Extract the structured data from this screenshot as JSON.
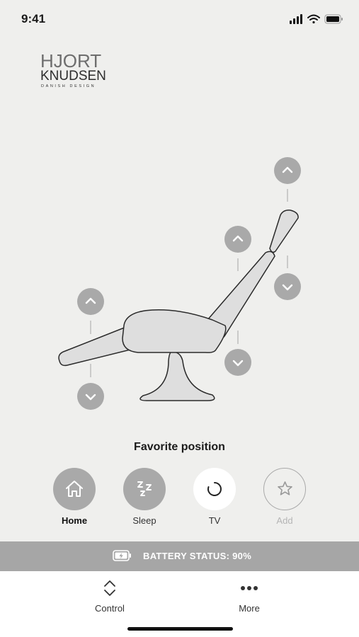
{
  "status_bar": {
    "time": "9:41"
  },
  "logo": {
    "line1": "HJORT",
    "line2": "KNUDSEN",
    "line3": "DANISH DESIGN"
  },
  "favorites": {
    "title": "Favorite position",
    "presets": [
      {
        "label": "Home",
        "icon": "home-icon",
        "state": "selected"
      },
      {
        "label": "Sleep",
        "icon": "sleep-icon",
        "state": "normal"
      },
      {
        "label": "TV",
        "icon": "spinner-icon",
        "state": "active"
      },
      {
        "label": "Add",
        "icon": "star-icon",
        "state": "disabled"
      }
    ]
  },
  "battery": {
    "text": "BATTERY STATUS: 90%",
    "level_percent": 90
  },
  "tabs": [
    {
      "label": "Control",
      "icon": "updown-icon"
    },
    {
      "label": "More",
      "icon": "more-dots-icon"
    }
  ],
  "colors": {
    "background": "#efefed",
    "button": "#a9a9a9",
    "battery_bar": "#a6a6a6",
    "chair_fill": "#dedede"
  }
}
